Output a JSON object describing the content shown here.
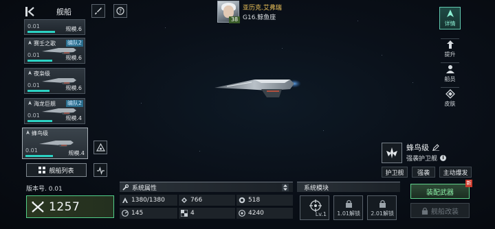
{
  "header": {
    "title": "舰船",
    "back_icon": "chevron-left-icon",
    "paint_icon": "brush-icon",
    "help_icon": "help-circle-icon"
  },
  "captain": {
    "name": "亚历克.艾弗瑞",
    "level": "38",
    "location": "G16.鲸鱼座"
  },
  "ship_list": [
    {
      "name": "",
      "tag": "",
      "level": "0.01",
      "scale": "规模.6",
      "progress": 0.55
    },
    {
      "name": "赛壬之歌",
      "tag": "编队2",
      "level": "0.01",
      "scale": "规模.6",
      "progress": 0.5
    },
    {
      "name": "夜枭级",
      "tag": "",
      "level": "0.01",
      "scale": "规模.6",
      "progress": 0.45
    },
    {
      "name": "海龙巨舰",
      "tag": "编队2",
      "level": "0.01",
      "scale": "规模.4",
      "progress": 0.5
    },
    {
      "name": "蜂鸟级",
      "tag": "",
      "level": "0.01",
      "scale": "规模.4",
      "progress": 0.5,
      "selected": true
    }
  ],
  "ship_list_button": "舰船列表",
  "version_label": "版本号. 0.01",
  "combat_power": "1257",
  "attributes": {
    "title": "系统属性",
    "stats": [
      {
        "icon": "armor-icon",
        "value": "1380/1380"
      },
      {
        "icon": "firepower-icon",
        "value": "766"
      },
      {
        "icon": "shield-icon",
        "value": "518"
      },
      {
        "icon": "speed-icon",
        "value": "145"
      },
      {
        "icon": "grid-icon",
        "value": "4"
      },
      {
        "icon": "target-icon",
        "value": "4240"
      }
    ]
  },
  "modules": {
    "title": "系统模块",
    "slots": [
      {
        "label": "Lv.1",
        "locked": false
      },
      {
        "label": "1.01解锁",
        "locked": true
      },
      {
        "label": "2.01解锁",
        "locked": true
      }
    ]
  },
  "ship_info": {
    "name": "蜂鸟级",
    "class": "强袭护卫舰",
    "roles": [
      "护卫舰",
      "强袭",
      "主动爆发"
    ]
  },
  "actions": {
    "equip": "装配武器",
    "equip_badge": "新",
    "refit": "舰船改装"
  },
  "tabs": [
    {
      "label": "详情",
      "active": true
    },
    {
      "label": "提升"
    },
    {
      "label": "船员"
    },
    {
      "label": "皮肤"
    }
  ],
  "colors": {
    "accent_green": "#5fd08a",
    "accent_teal": "#2bd3c4",
    "captain_gold": "#f2c75c",
    "badge_red": "#cc3a2c"
  }
}
